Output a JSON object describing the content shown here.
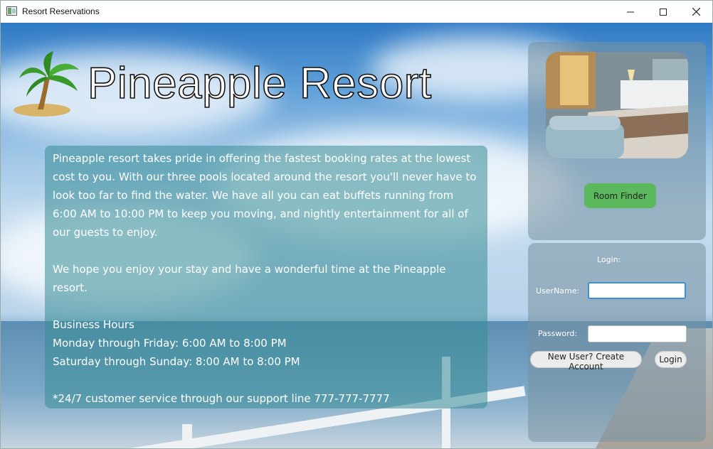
{
  "window": {
    "title": "Resort Reservations"
  },
  "header": {
    "title": "Pineapple Resort"
  },
  "info": {
    "paragraph1": "Pineapple resort takes pride in offering the fastest booking rates at the lowest cost to you. With our three pools located around the resort you'll never have to look too far to find the water. We have all you can eat buffets running from 6:00 AM to 10:00 PM to keep you moving, and nightly entertainment for all of our guests to enjoy.",
    "paragraph2": "We hope you enjoy your stay and have a wonderful time at the Pineapple resort.",
    "hours_title": "Business Hours",
    "hours_weekday": "Monday through Friday: 6:00 AM to 8:00 PM",
    "hours_weekend": "Saturday through Sunday: 8:00 AM to 8:00 PM",
    "support": "*24/7 customer service through our support line 777-777-7777"
  },
  "room_finder": {
    "label": "Room Finder"
  },
  "login": {
    "title": "Login:",
    "username_label": "UserName:",
    "username_value": "",
    "password_label": "Password:",
    "password_value": "",
    "new_user_label": "New User? Create Account",
    "login_label": "Login"
  },
  "colors": {
    "room_finder": "#5cb85c",
    "focus": "#3c8fd8"
  },
  "icons": {
    "logo": "palm-tree-icon",
    "app": "app-window-icon"
  }
}
